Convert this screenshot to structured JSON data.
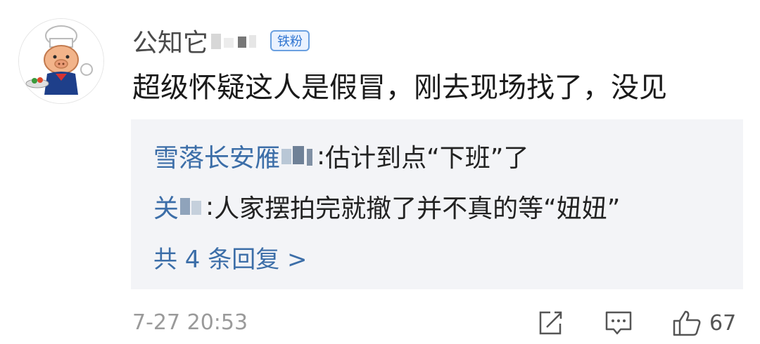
{
  "comment": {
    "username": "公知它",
    "badge": "铁粉",
    "text": "超级怀疑这人是假冒，刚去现场找了，没见"
  },
  "replies": [
    {
      "author": "雪落长安雁",
      "separator": ":",
      "text": " 估计到点“下班”了"
    },
    {
      "author": "关",
      "separator": ":",
      "text": " 人家摆拍完就撤了并不真的等“妞妞”"
    }
  ],
  "more_replies_label": "共 4 条回复 >",
  "footer": {
    "timestamp": "7-27 20:53",
    "like_count": "67",
    "icons": [
      "share-icon",
      "reply-icon",
      "like-icon"
    ]
  },
  "colors": {
    "link_blue": "#3c6ea8",
    "badge_blue": "#2f74d0",
    "reply_bg": "#f3f4f7",
    "meta_gray": "#9a9a9a"
  }
}
